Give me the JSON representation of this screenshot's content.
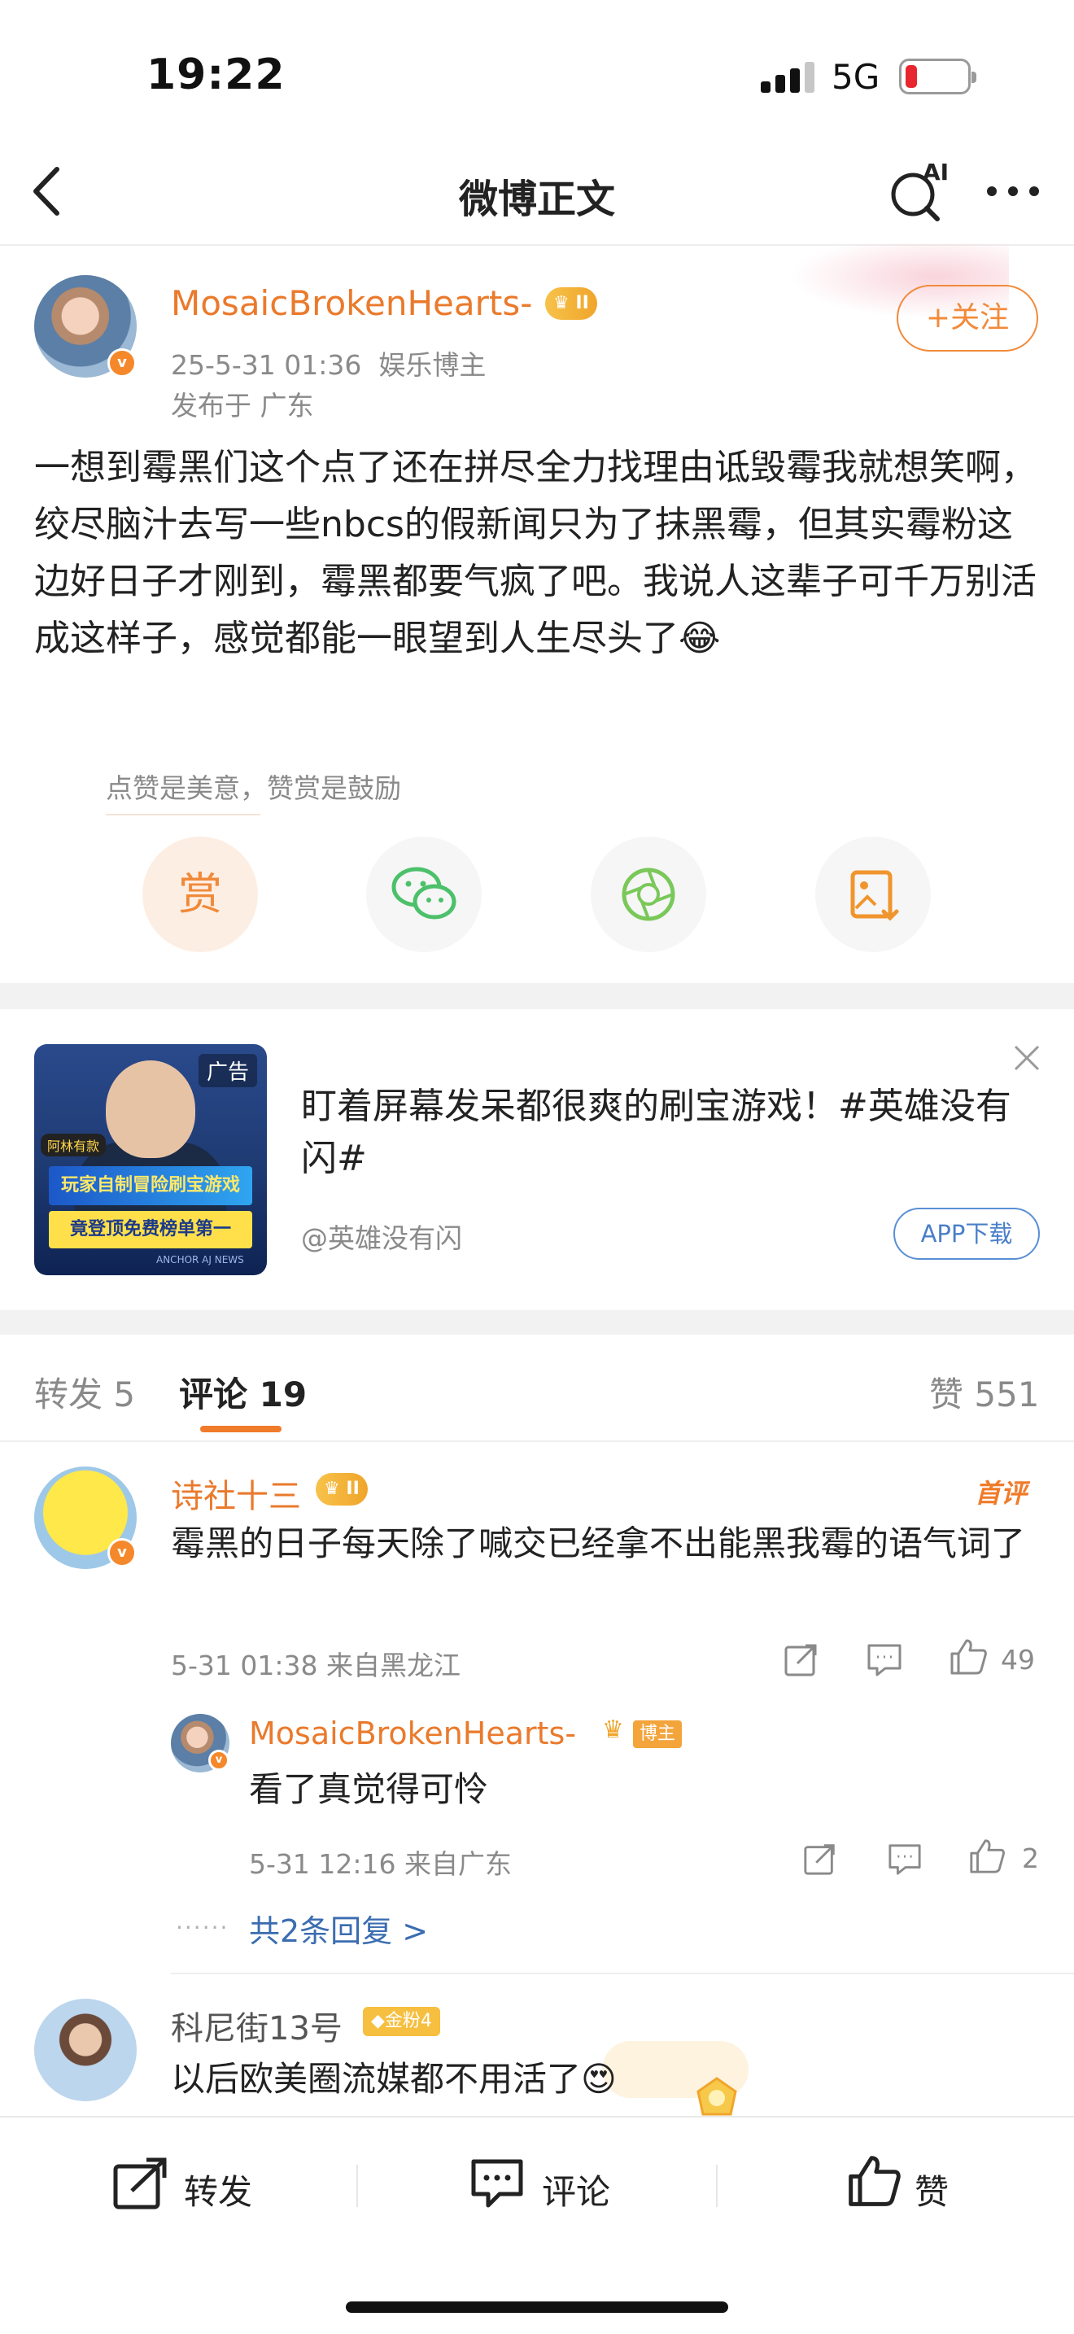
{
  "status_bar": {
    "time": "19:22",
    "network": "5G"
  },
  "nav": {
    "title": "微博正文",
    "ai_label": "AI"
  },
  "post": {
    "author": "MosaicBrokenHearts-",
    "crown_badge": "II",
    "date": "25-5-31 01:36",
    "author_tag": "娱乐博主",
    "location": "发布于 广东",
    "follow_label": "+关注",
    "body": "一想到霉黑们这个点了还在拼尽全力找理由诋毁霉我就想笑啊，绞尽脑汁去写一些nbcs的假新闻只为了抹黑霉，但其实霉粉这边好日子才刚到，霉黑都要气疯了吧。我说人这辈子可千万别活成这样子，感觉都能一眼望到人生尽头了😂",
    "reward_tip": "点赞是美意，赞赏是鼓励",
    "reward_label": "赏"
  },
  "ad": {
    "tag": "广告",
    "host_label": "阿林有款",
    "banner_line1": "玩家自制冒险刷宝游戏",
    "banner_line2": "竟登顶免费榜单第一",
    "image_caption": "ANCHOR AJ NEWS",
    "title": "盯着屏幕发呆都很爽的刷宝游戏！#英雄没有闪#",
    "source": "@英雄没有闪",
    "download_label": "APP下载"
  },
  "tabs": {
    "repost": "转发 5",
    "comments": "评论 19",
    "likes": "赞 551"
  },
  "comments": [
    {
      "name": "诗社十三",
      "crown_badge": "II",
      "first_tag": "首评",
      "text": "霉黑的日子每天除了喊交已经拿不出能黑我霉的语气词了",
      "meta": "5-31 01:38  来自黑龙江",
      "likes": "49",
      "reply": {
        "name": "MosaicBrokenHearts-",
        "role_tag": "博主",
        "text": "看了真觉得可怜",
        "meta": "5-31 12:16  来自广东",
        "likes": "2"
      },
      "more_replies": "共2条回复 >"
    },
    {
      "name": "科尼街13号",
      "fan_tag": "金粉4",
      "text": "以后欧美圈流媒都不用活了😍"
    }
  ],
  "bottom_bar": {
    "repost": "转发",
    "comment": "评论",
    "like": "赞"
  },
  "colors": {
    "accent_orange": "#ea7a2c",
    "link_blue": "#3b6db0",
    "crown_gold": "#f0a52b"
  }
}
